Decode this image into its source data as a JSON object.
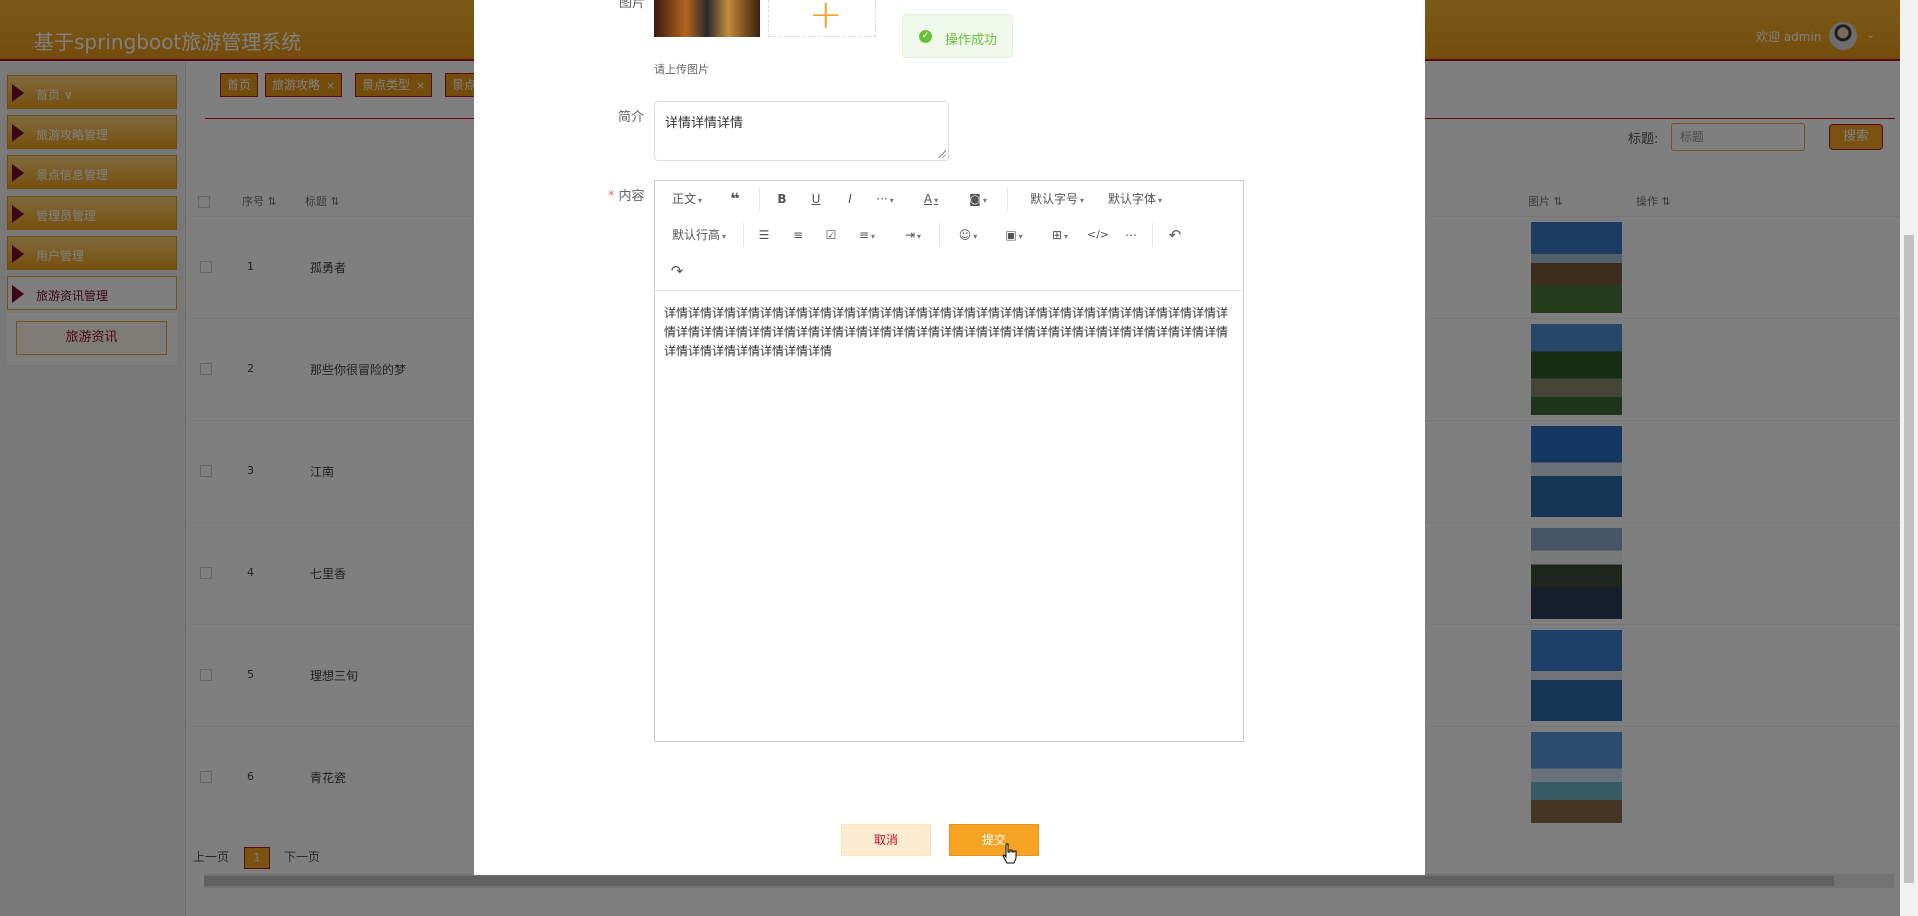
{
  "app": {
    "title": "基于springboot旅游管理系统",
    "welcome": "欢迎 admin"
  },
  "sidebar": {
    "items": [
      {
        "label": "首页 ∨"
      },
      {
        "label": "旅游攻略管理"
      },
      {
        "label": "景点信息管理"
      },
      {
        "label": "管理员管理"
      },
      {
        "label": "用户管理"
      },
      {
        "label": "旅游资讯管理"
      }
    ],
    "subitem": "旅游资讯"
  },
  "tabs": [
    {
      "label": "首页"
    },
    {
      "label": "旅游攻略"
    },
    {
      "label": "景点类型"
    },
    {
      "label": "景点"
    }
  ],
  "search": {
    "label": "标题:",
    "placeholder": "标题",
    "button": "搜索"
  },
  "table": {
    "headers": {
      "index": "序号",
      "title": "标题",
      "image": "图片",
      "action": "操作"
    },
    "rows": [
      {
        "index": "1",
        "title": "孤勇者"
      },
      {
        "index": "2",
        "title": "那些你很冒险的梦"
      },
      {
        "index": "3",
        "title": "江南"
      },
      {
        "index": "4",
        "title": "七里香"
      },
      {
        "index": "5",
        "title": "理想三旬"
      },
      {
        "index": "6",
        "title": "青花瓷"
      }
    ]
  },
  "pagination": {
    "prev": "上一页",
    "current": "1",
    "next": "下一页"
  },
  "dialog": {
    "image_label": "图片",
    "upload_hint": "请上传图片",
    "toast": "操作成功",
    "intro_label": "简介",
    "intro_value": "详情详情详情",
    "content_label": "内容",
    "toolbar": {
      "paragraph": "正文",
      "font_size": "默认字号",
      "font_family": "默认字体",
      "line_height": "默认行高"
    },
    "content_text": "详情详情详情详情详情详情详情详情详情详情详情详情详情详情详情详情详情详情详情详情详情详情详情详情详情详情详情详情详情详情详情详情详情详情详情详情详情详情详情详情详情详情详情详情详情详情详情详情详情详情详情详情详情详情",
    "cancel": "取消",
    "submit": "提交"
  },
  "colors": {
    "accent": "#f4a422",
    "brand_dark": "#c6112f",
    "success": "#67c23a"
  }
}
